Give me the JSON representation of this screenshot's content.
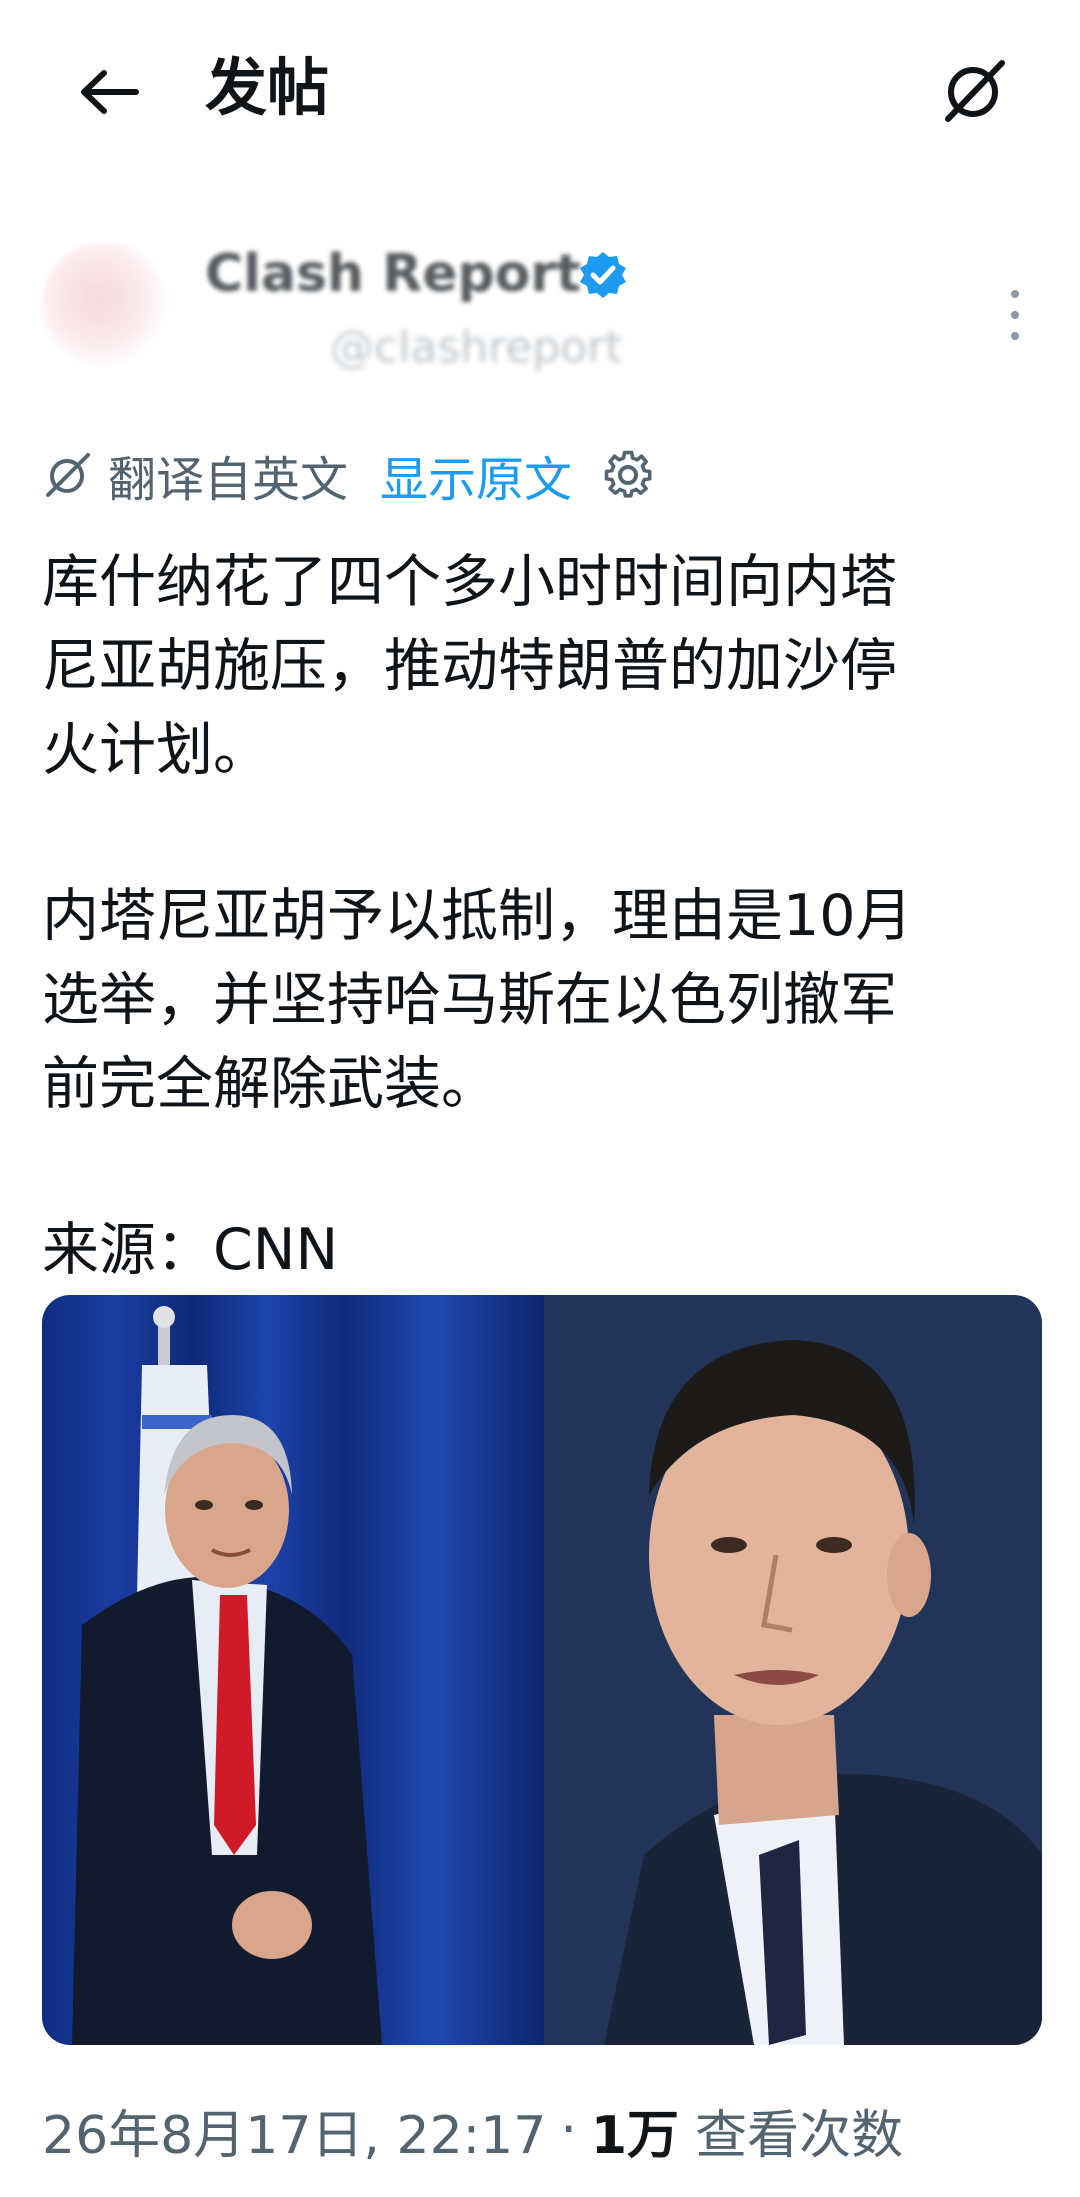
{
  "header": {
    "title": "发帖",
    "back_icon": "back-arrow-icon",
    "grok_icon": "grok-icon"
  },
  "author": {
    "name": "Clash Report",
    "handle": "@clashreport",
    "verified_color": "#1d9bf0"
  },
  "translation": {
    "translated_from": "翻译自英文",
    "show_original": "显示原文",
    "link_color": "#1d9bf0"
  },
  "post": {
    "paragraphs": [
      "库什纳花了四个多小时时间向内塔\n尼亚胡施压，推动特朗普的加沙停\n火计划。",
      "内塔尼亚胡予以抵制，理由是10月\n选举，并坚持哈马斯在以色列撤军\n前完全解除武装。",
      "来源：CNN"
    ]
  },
  "meta": {
    "timestamp": "26年8月17日, 22:17",
    "separator": "·",
    "view_count": "1万",
    "view_label": "查看次数"
  }
}
